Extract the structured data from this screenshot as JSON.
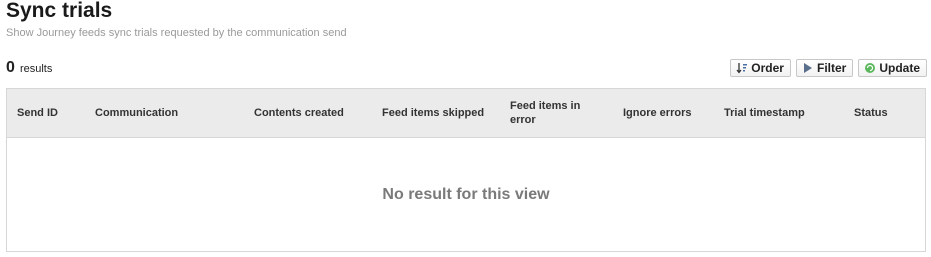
{
  "page": {
    "title": "Sync trials",
    "subtitle": "Show Journey feeds sync trials requested by the communication send"
  },
  "results": {
    "count": "0",
    "label": "results"
  },
  "toolbar": {
    "order_label": "Order",
    "order_icon": "sort-icon",
    "filter_label": "Filter",
    "filter_icon": "filter-icon",
    "update_label": "Update",
    "update_icon": "refresh-icon",
    "update_icon_color": "#5cb85c"
  },
  "table": {
    "columns": [
      "Send ID",
      "Communication",
      "Contents created",
      "Feed items skipped",
      "Feed items in error",
      "Ignore errors",
      "Trial timestamp",
      "Status"
    ],
    "empty_message": "No result for this view"
  }
}
